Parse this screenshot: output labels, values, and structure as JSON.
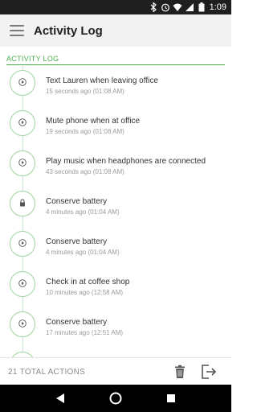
{
  "status_bar": {
    "time": "1:09",
    "icons": [
      "bluetooth-icon",
      "alarm-icon",
      "wifi-icon",
      "signal-icon",
      "battery-icon"
    ]
  },
  "app_bar": {
    "title": "Activity Log",
    "menu_icon": "hamburger-menu-icon"
  },
  "section": {
    "header": "ACTIVITY LOG"
  },
  "activity": [
    {
      "name": "Text Lauren when leaving office",
      "time": "15 seconds ago (01:08 AM)",
      "icon": "play-icon"
    },
    {
      "name": "Mute phone when at office",
      "time": "19 seconds ago (01:08 AM)",
      "icon": "play-icon"
    },
    {
      "name": "Play music when headphones are connected",
      "time": "43 seconds ago (01:08 AM)",
      "icon": "play-icon"
    },
    {
      "name": "Conserve battery",
      "time": "4 minutes ago (01:04 AM)",
      "icon": "lock-icon"
    },
    {
      "name": "Conserve battery",
      "time": "4 minutes ago (01:04 AM)",
      "icon": "play-icon"
    },
    {
      "name": "Check in at coffee shop",
      "time": "10 minutes ago (12:58 AM)",
      "icon": "play-icon"
    },
    {
      "name": "Conserve battery",
      "time": "17 minutes ago (12:51 AM)",
      "icon": "play-icon"
    }
  ],
  "footer": {
    "total_label": "21 TOTAL ACTIONS",
    "actions": [
      "trash-icon",
      "exit-icon"
    ]
  },
  "nav_bar": {
    "buttons": [
      "back-icon",
      "home-icon",
      "recents-icon"
    ]
  },
  "colors": {
    "accent": "#4caf50",
    "status_bar": "#1f1f1f",
    "app_bar": "#f2f2f2",
    "timeline": "#9fd49f",
    "text_primary": "#333333",
    "text_secondary": "#9a9a9a"
  }
}
